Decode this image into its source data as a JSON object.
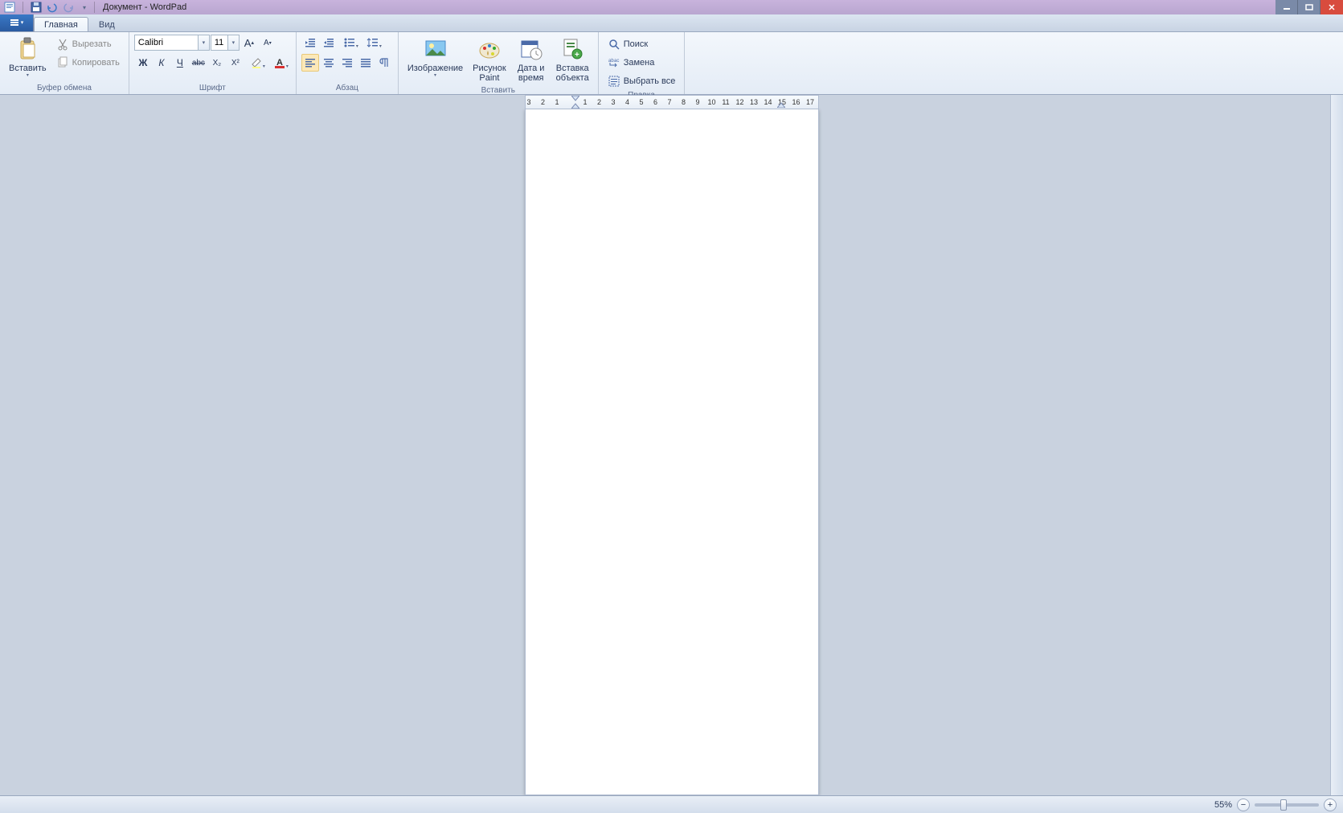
{
  "window": {
    "title": "Документ - WordPad"
  },
  "tabs": {
    "home": "Главная",
    "view": "Вид"
  },
  "clipboard": {
    "paste": "Вставить",
    "cut": "Вырезать",
    "copy": "Копировать",
    "group_label": "Буфер обмена"
  },
  "font": {
    "family": "Calibri",
    "size": "11",
    "group_label": "Шрифт",
    "bold": "Ж",
    "italic": "К",
    "underline": "Ч",
    "strike": "abc",
    "subscript": "X₂",
    "superscript": "X²",
    "grow": "A",
    "shrink": "A"
  },
  "paragraph": {
    "group_label": "Абзац"
  },
  "insert": {
    "image": "Изображение",
    "paint": "Рисунок\nPaint",
    "datetime": "Дата и\nвремя",
    "object": "Вставка\nобъекта",
    "group_label": "Вставить"
  },
  "editing": {
    "find": "Поиск",
    "replace": "Замена",
    "select_all": "Выбрать все",
    "group_label": "Правка"
  },
  "ruler": {
    "neg": [
      "3",
      "2",
      "1"
    ],
    "pos": [
      "1",
      "2",
      "3",
      "4",
      "5",
      "6",
      "7",
      "8",
      "9",
      "10",
      "11",
      "12",
      "13",
      "14",
      "15",
      "16",
      "17"
    ]
  },
  "status": {
    "zoom": "55%"
  }
}
